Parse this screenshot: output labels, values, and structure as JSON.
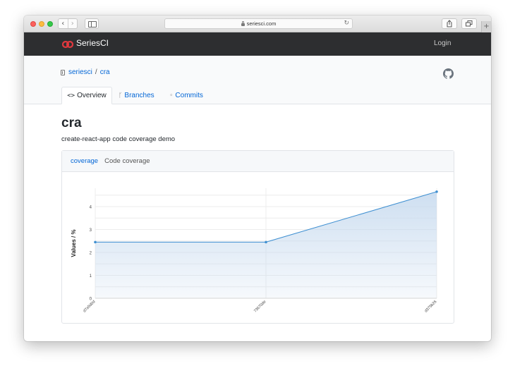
{
  "browser": {
    "url": "seriesci.com",
    "back_glyph": "‹",
    "forward_glyph": "›",
    "reload_glyph": "↻",
    "new_tab_glyph": "+"
  },
  "app": {
    "brand": "SeriesCI",
    "login_label": "Login",
    "brand_color": "#e0383e"
  },
  "breadcrumb": {
    "owner": "seriesci",
    "separator": "/",
    "repo": "cra"
  },
  "tabs": [
    {
      "label": "Overview",
      "icon": "code-icon",
      "glyph": "<>"
    },
    {
      "label": "Branches",
      "icon": "branch-icon",
      "glyph": "ᚴ"
    },
    {
      "label": "Commits",
      "icon": "commit-icon",
      "glyph": "◦"
    }
  ],
  "repo": {
    "title": "cra",
    "description": "create-react-app code coverage demo"
  },
  "card": {
    "tab_active": "coverage",
    "tab_label": "Code coverage"
  },
  "chart_data": {
    "type": "area",
    "x": [
      "d7a5d0d",
      "73670de",
      "d375b26"
    ],
    "y": [
      2.45,
      2.45,
      4.65
    ],
    "ylabel": "Values / %",
    "xlabel": "",
    "ylim": [
      0,
      4.8
    ],
    "yticks": [
      0,
      1,
      2,
      3,
      4
    ],
    "grid": true,
    "line_color": "#3e8fd1",
    "fill_color": "#c5d9ee"
  }
}
